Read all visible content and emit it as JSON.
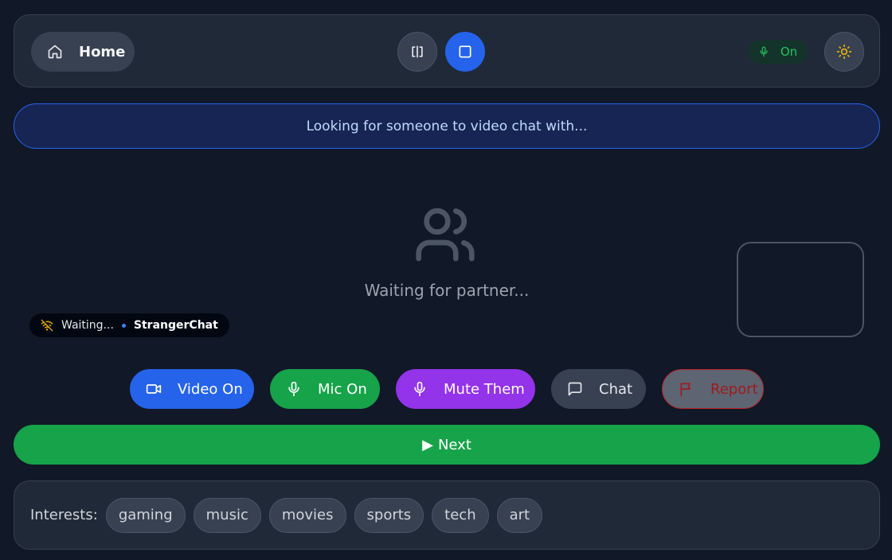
{
  "header": {
    "home_label": "Home",
    "mic_status": "On"
  },
  "banner": {
    "text": "Looking for someone to video chat with..."
  },
  "stage": {
    "waiting_text": "Waiting for partner...",
    "status_text": "Waiting...",
    "brand": "StrangerChat"
  },
  "controls": {
    "video": "Video On",
    "mic": "Mic On",
    "mute": "Mute Them",
    "chat": "Chat",
    "report": "Report"
  },
  "next": {
    "icon": "▶",
    "label": "Next"
  },
  "interests": {
    "label": "Interests:",
    "tags": [
      "gaming",
      "music",
      "movies",
      "sports",
      "tech",
      "art"
    ]
  },
  "colors": {
    "background": "#111827",
    "panel": "#1f2937",
    "primary": "#2563eb",
    "success": "#16a34a",
    "purple": "#9333ea",
    "danger": "#dc2626",
    "warning": "#eab308"
  },
  "icons": {
    "home": "home-icon",
    "split_layout": "split-layout-icon",
    "single_layout": "square-icon",
    "mic": "mic-icon",
    "theme": "sun-icon",
    "users": "users-icon",
    "no_signal": "wifi-off-icon",
    "video": "video-icon",
    "chat": "message-square-icon",
    "report": "flag-icon"
  }
}
